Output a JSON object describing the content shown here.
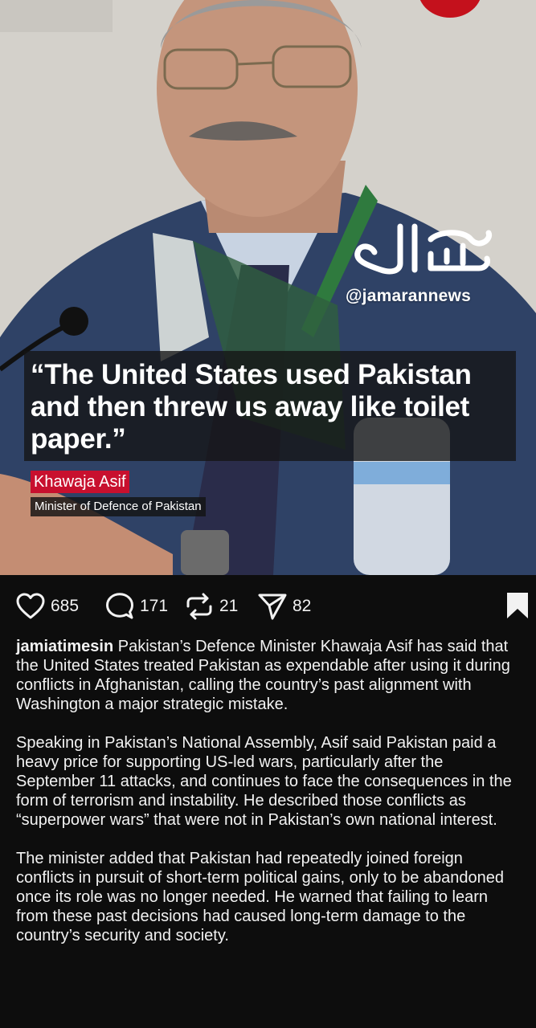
{
  "post": {
    "image": {
      "quote": "“The United States used Pakistan and then threw us away like toilet paper.”",
      "speaker_name": "Khawaja Asif",
      "speaker_role": "Minister of Defence of Pakistan",
      "watermark_handle": "@jamarannews",
      "watermark_logo_icon": "jamaran-logo-icon"
    },
    "actions": {
      "likes": "685",
      "comments": "171",
      "reposts": "21",
      "shares": "82"
    },
    "caption": {
      "username": "jamiatimesin",
      "paragraphs": [
        "Pakistan’s Defence Minister Khawaja Asif has said that the United States treated Pakistan as expendable after using it during conflicts in Afghanistan, calling the country’s past alignment with Washington a major strategic mistake.",
        "Speaking in Pakistan’s National Assembly, Asif said Pakistan paid a heavy price for supporting US-led wars, particularly after the September 11 attacks, and continues to face the consequences in the form of terrorism and instability. He described those conflicts as “superpower wars” that were not in Pakistan’s own national interest.",
        "The minister added that Pakistan had repeatedly joined foreign conflicts in pursuit of short-term political gains, only to be abandoned once its role was no longer needed. He warned that failing to learn from these past decisions had caused long-term damage to the country’s security and society."
      ]
    }
  },
  "colors": {
    "background": "#0d0d0d",
    "text": "#f2f2f2",
    "name_tag": "#c8102e"
  }
}
